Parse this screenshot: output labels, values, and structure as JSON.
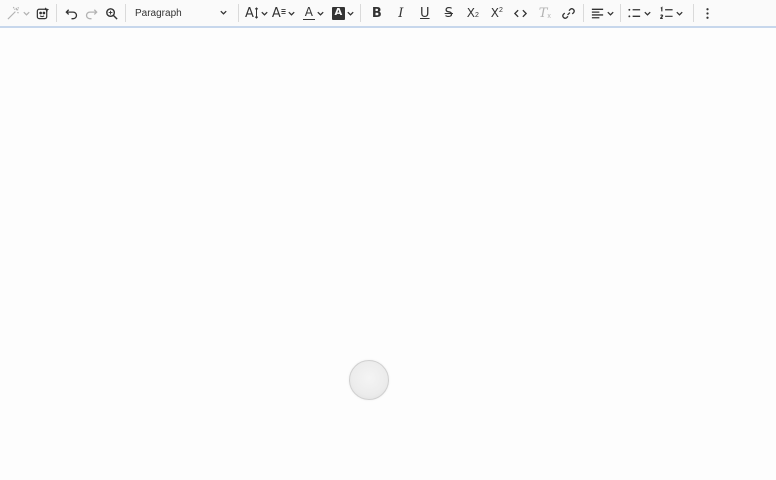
{
  "toolbar": {
    "heading_value": "Paragraph",
    "text_color_letter": "A",
    "bg_color_letter": "A",
    "bold_glyph": "B",
    "italic_glyph": "I",
    "underline_glyph": "U",
    "strike_glyph": "S",
    "code_glyph": "<>",
    "remove_format_glyph": "T",
    "subscript_glyph": "X",
    "superscript_glyph": "X",
    "font_size_glyph": "A",
    "font_family_glyph": "A"
  },
  "icons": [
    "magic-wand-icon",
    "template-icon",
    "undo-icon",
    "redo-icon",
    "find-replace-icon",
    "font-size-icon",
    "font-family-icon",
    "text-color-icon",
    "background-color-icon",
    "bold-icon",
    "italic-icon",
    "underline-icon",
    "strikethrough-icon",
    "subscript-icon",
    "superscript-icon",
    "code-icon",
    "remove-format-icon",
    "link-icon",
    "align-icon",
    "bulleted-list-icon",
    "numbered-list-icon",
    "more-icon"
  ],
  "colors": {
    "toolbar_bg": "#fafafa",
    "toolbar_border": "#c7d7ec",
    "disabled": "#b3b3b3"
  }
}
